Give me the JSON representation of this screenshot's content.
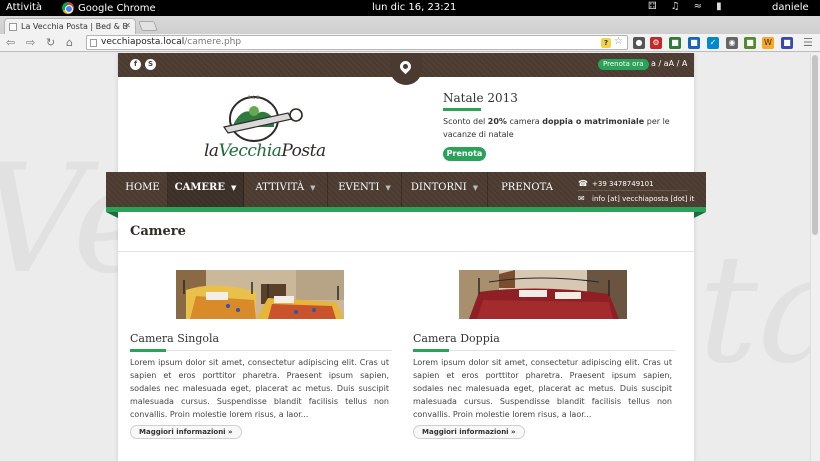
{
  "system_bar": {
    "activities": "Attività",
    "app_name": "Google Chrome",
    "clock": "lun dic 16, 23:21",
    "user": "daniele"
  },
  "browser": {
    "tab_title": "La Vecchia Posta | Bed & B",
    "url_host": "vecchiaposta.local",
    "url_path": "/camere.php",
    "icons": [
      "back-icon",
      "forward-icon",
      "reload-icon",
      "home-icon",
      "star-icon",
      "menu-icon"
    ]
  },
  "site": {
    "background_text_left": "Ve",
    "background_text_right": "ta",
    "top_bar": {
      "social_icons": [
        "facebook-icon",
        "skype-icon"
      ],
      "prenota_ora": "Prenota ora",
      "font_sizes": "a / aA / A"
    },
    "logo": {
      "text_la": "la",
      "text_vecchia": "Vecchia",
      "text_posta": "Posta"
    },
    "promo": {
      "title": "Natale 2013",
      "text_pre": "Sconto del ",
      "text_pct": "20%",
      "text_mid": " camera ",
      "text_bold": "doppia o matrimoniale",
      "text_post": " per le vacanze di natale",
      "button": "Prenota"
    },
    "nav": {
      "items": [
        {
          "label": "HOME",
          "dropdown": false
        },
        {
          "label": "CAMERE",
          "dropdown": true,
          "active": true
        },
        {
          "label": "ATTIVITÀ",
          "dropdown": true
        },
        {
          "label": "EVENTI",
          "dropdown": true
        },
        {
          "label": "DINTORNI",
          "dropdown": true
        },
        {
          "label": "PRENOTA",
          "dropdown": false
        }
      ],
      "phone": "+39 3478749101",
      "email": "info [at] vecchiaposta [dot] it"
    },
    "page_title": "Camere",
    "rooms": [
      {
        "name": "Camera Singola",
        "description": "Lorem ipsum dolor sit amet, consectetur adipiscing elit. Cras ut sapien et eros porttitor pharetra. Praesent ipsum sapien, sodales nec malesuada eget, placerat ac metus. Duis suscipit malesuada cursus. Suspendisse blandit facilisis tellus non convallis. Proin molestie lorem risus, a laor...",
        "button": "Maggiori informazioni »"
      },
      {
        "name": "Camera Doppia",
        "description": "Lorem ipsum dolor sit amet, consectetur adipiscing elit. Cras ut sapien et eros porttitor pharetra. Praesent ipsum sapien, sodales nec malesuada eget, placerat ac metus. Duis suscipit malesuada cursus. Suspendisse blandit facilisis tellus non convallis. Proin molestie lorem risus, a laor...",
        "button": "Maggiori informazioni »"
      }
    ]
  },
  "colors": {
    "brand_brown": "#4a3a30",
    "accent_green": "#2aa25a"
  }
}
